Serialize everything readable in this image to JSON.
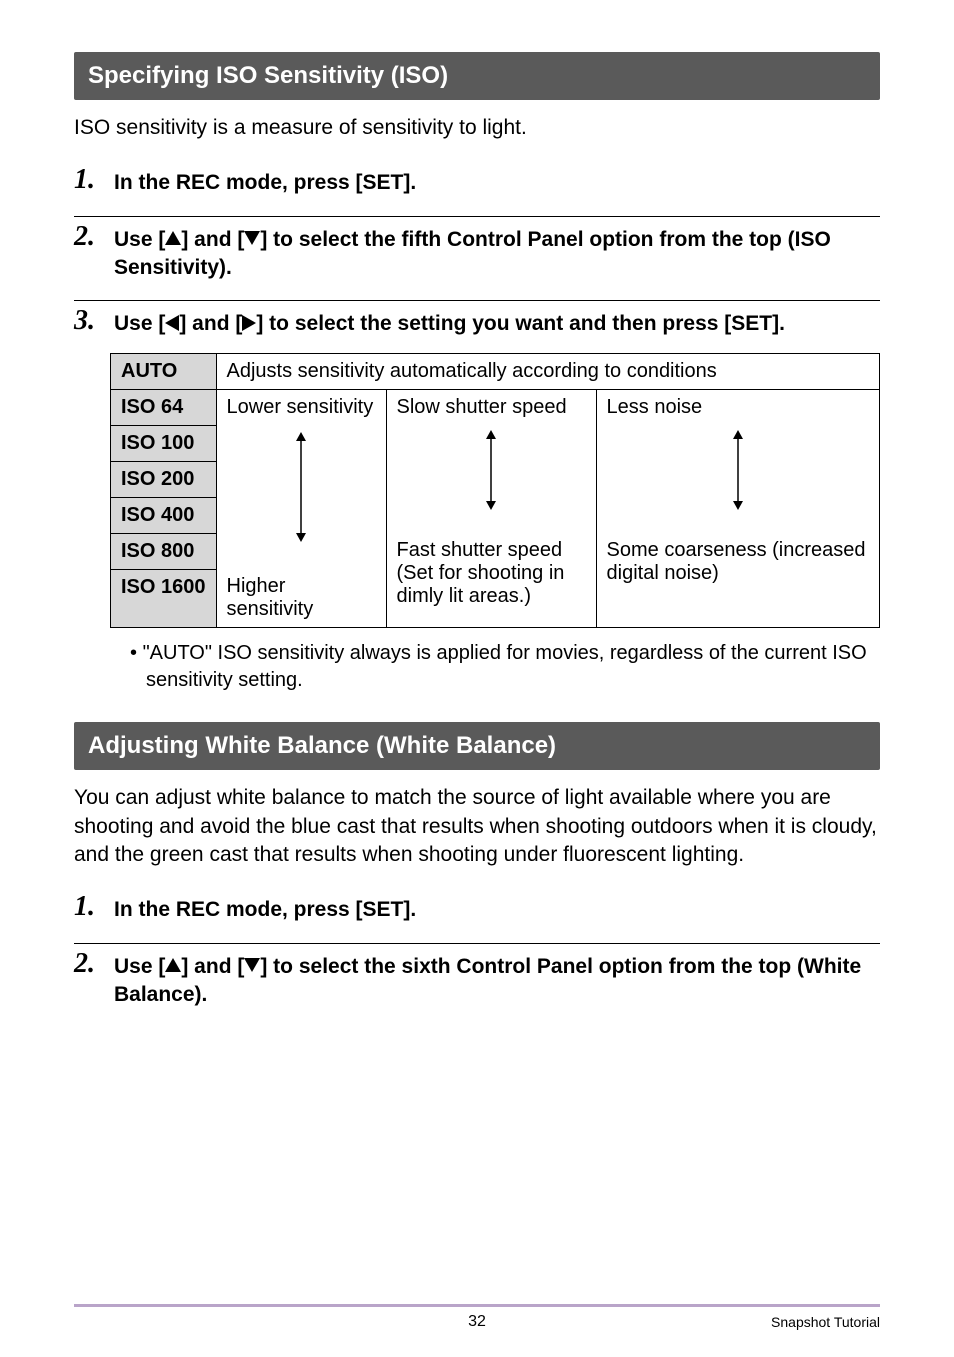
{
  "section1": {
    "title": "Specifying ISO Sensitivity (ISO)",
    "intro": "ISO sensitivity is a measure of sensitivity to light.",
    "steps": {
      "1": "In the REC mode, press [SET].",
      "2a": "Use [",
      "2b": "] and [",
      "2c": "] to select the fifth Control Panel option from the top (ISO Sensitivity).",
      "3a": "Use [",
      "3b": "] and [",
      "3c": "] to select the setting you want and then press [SET]."
    },
    "table": {
      "rows": [
        "AUTO",
        "ISO 64",
        "ISO 100",
        "ISO 200",
        "ISO 400",
        "ISO 800",
        "ISO 1600"
      ],
      "auto_desc": "Adjusts sensitivity automatically according to conditions",
      "col1_top": "Lower sensitivity",
      "col2_top": "Slow shutter speed",
      "col3_top": "Less noise",
      "col1_bot": "Higher sensitivity",
      "col2_bot": "Fast shutter speed (Set for shooting in dimly lit areas.)",
      "col3_bot": "Some coarseness (increased digital noise)"
    },
    "note": "\"AUTO\" ISO sensitivity always is applied for movies, regardless of the current ISO sensitivity setting."
  },
  "section2": {
    "title": "Adjusting White Balance (White Balance)",
    "intro": "You can adjust white balance to match the source of light available where you are shooting and avoid the blue cast that results when shooting outdoors when it is cloudy, and the green cast that results when shooting under fluorescent lighting.",
    "steps": {
      "1": "In the REC mode, press [SET].",
      "2a": "Use [",
      "2b": "] and [",
      "2c": "] to select the sixth Control Panel option from the top (White Balance)."
    }
  },
  "footer": {
    "page": "32",
    "label": "Snapshot Tutorial"
  }
}
